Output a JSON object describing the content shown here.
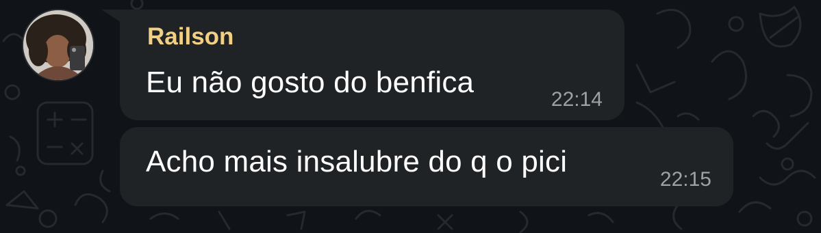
{
  "chat": {
    "messages": [
      {
        "sender": "Railson",
        "text": "Eu não gosto do benfica",
        "time": "22:14"
      },
      {
        "text": "Acho mais insalubre do q o pici",
        "time": "22:15"
      }
    ]
  },
  "avatar": {
    "icon": "user-avatar-photo"
  },
  "colors": {
    "background": "#101418",
    "bubble": "#202326",
    "sender_name": "#f1cf84",
    "message_text": "#ffffff",
    "timestamp": "#9ea1a5"
  }
}
